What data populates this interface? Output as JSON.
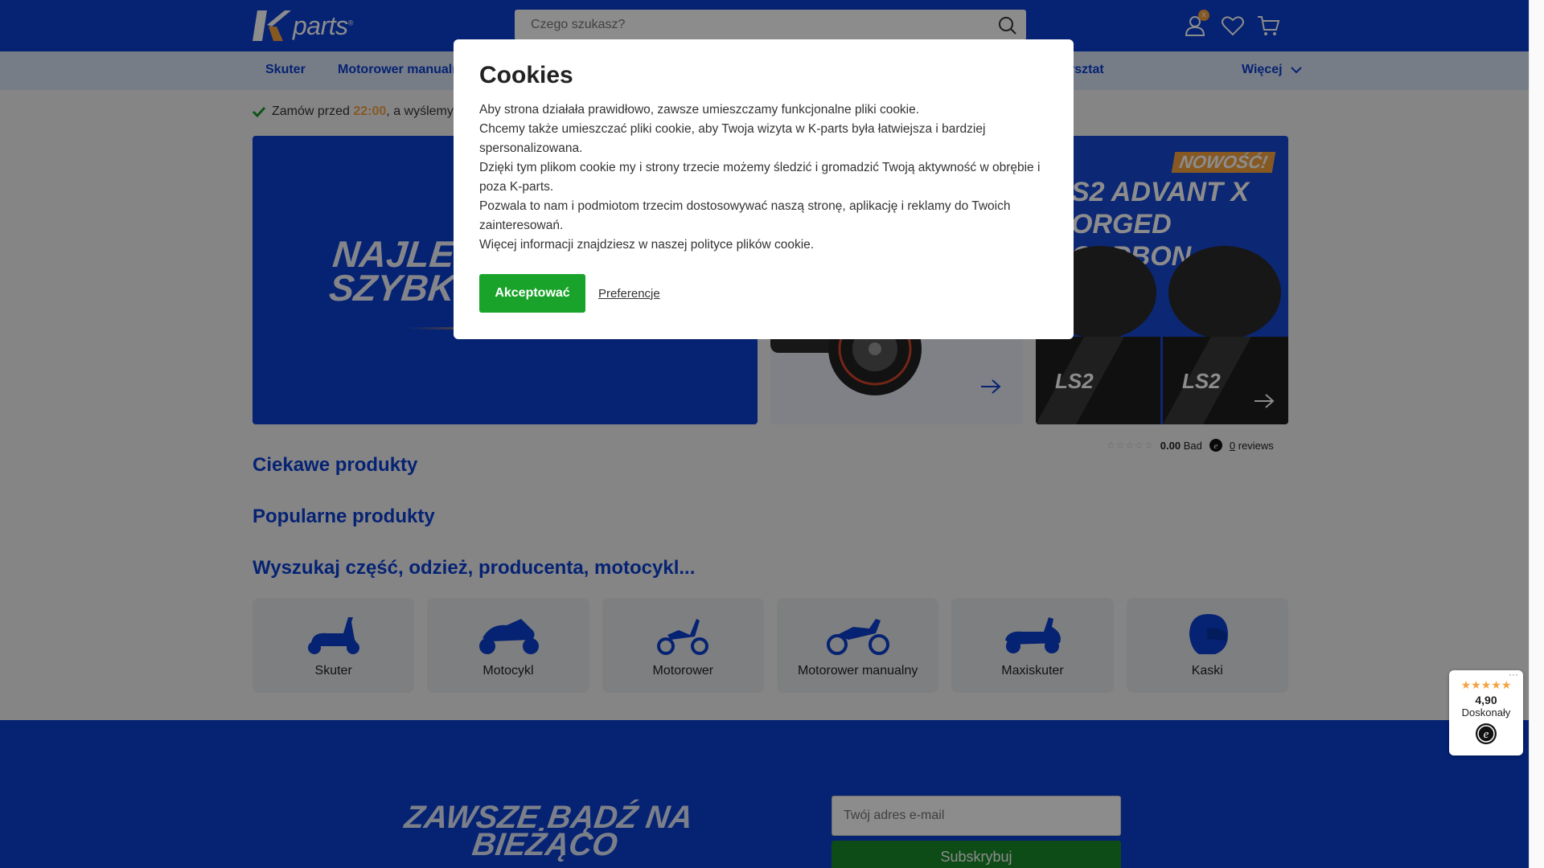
{
  "header": {
    "logo_text": "parts",
    "logo_mark": "®",
    "search_placeholder": "Czego szukasz?",
    "account_badge": "x"
  },
  "nav": {
    "items": [
      "Skuter",
      "Motorower manualny",
      "rsztat"
    ],
    "more_label": "Więcej"
  },
  "notice": {
    "prefix": "Zamów przed",
    "hour": "22:00",
    "suffix": ", a wyślemy"
  },
  "banners": {
    "main_text_line1": "NAJLEP",
    "main_text_line2": "SZYBK",
    "right_badge": "NOWOŚĆ!",
    "right_title_line1": "S2 ADVANT X",
    "right_title_line2": "ORGED CARBON",
    "helmet_brand": "LS2"
  },
  "reviews": {
    "stars": "☆☆☆☆☆",
    "score": "0.00",
    "rating_word": "Bad",
    "count": "0",
    "count_suffix": "reviews"
  },
  "sections": {
    "interesting": "Ciekawe produkty",
    "popular": "Popularne produkty",
    "search_heading": "Wyszukaj część, odzież, producenta, motocykl..."
  },
  "categories": [
    {
      "label": "Skuter",
      "icon": "scooter-icon"
    },
    {
      "label": "Motocykl",
      "icon": "motorcycle-icon"
    },
    {
      "label": "Motorower",
      "icon": "moped-icon"
    },
    {
      "label": "Motorower manualny",
      "icon": "dirt-bike-icon"
    },
    {
      "label": "Maxiskuter",
      "icon": "maxiscooter-icon"
    },
    {
      "label": "Kaski",
      "icon": "helmet-icon"
    }
  ],
  "footer": {
    "title_line1": "ZAWSZE BĄDŹ NA",
    "title_line2": "BIEŻĄCO",
    "email_placeholder": "Twój adres e-mail",
    "subscribe_label": "Subskrybuj"
  },
  "cookies": {
    "title": "Cookies",
    "paragraphs": [
      "Aby strona działała prawidłowo, zawsze umieszczamy funkcjonalne pliki cookie.",
      "Chcemy także umieszczać pliki cookie, aby Twoja wizyta w K-parts była łatwiejsza i bardziej spersonalizowana.",
      "Dzięki tym plikom cookie my i strony trzecie możemy śledzić i gromadzić Twoją aktywność w obrębie i poza K-parts.",
      "Pozwala to nam i podmiotom trzecim dostosowywać naszą stronę, aplikację i reklamy do Twoich zainteresowań.",
      "Więcej informacji znajdziesz w naszej polityce plików cookie."
    ],
    "accept_label": "Akceptować",
    "preferences_label": "Preferencje"
  },
  "trust_widget": {
    "stars": "★★★★★",
    "score": "4,90",
    "rating_word": "Doskonały",
    "menu": "···"
  },
  "colors": {
    "brand_blue": "#0a3fd1",
    "accent_orange": "#f4a341",
    "accept_green": "#1aa32a"
  }
}
